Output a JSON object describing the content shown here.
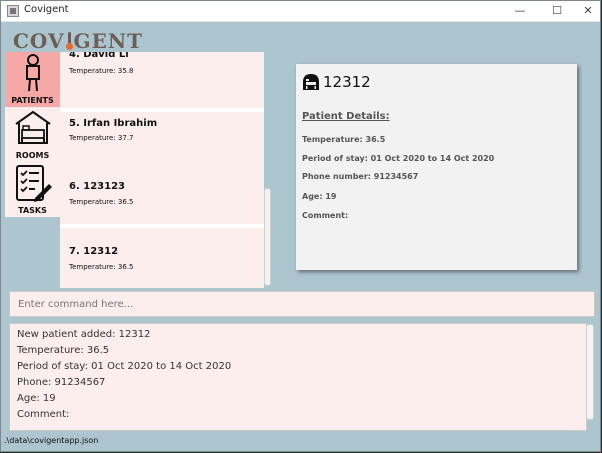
{
  "window": {
    "title": "Covigent"
  },
  "logo": {
    "text_before": "COV",
    "text_after": "GENT"
  },
  "sidebar": {
    "items": [
      {
        "label": "PATIENTS",
        "icon": "person-icon",
        "active": true
      },
      {
        "label": "ROOMS",
        "icon": "bed-icon",
        "active": false
      },
      {
        "label": "TASKS",
        "icon": "checklist-icon",
        "active": false
      }
    ]
  },
  "patients": [
    {
      "name": "4.  David Li",
      "temperature": "Temperature: 35.8"
    },
    {
      "name": "5.  Irfan Ibrahim",
      "temperature": "Temperature: 37.7"
    },
    {
      "name": "6.  123123",
      "temperature": "Temperature: 36.5"
    },
    {
      "name": "7.  12312",
      "temperature": "Temperature: 36.5"
    }
  ],
  "details": {
    "patient_id": "12312",
    "header": "Patient Details:",
    "temperature": "Temperature: 36.5",
    "period": "Period of stay: 01 Oct 2020 to 14 Oct 2020",
    "phone": "Phone number: 91234567",
    "age": "Age: 19",
    "comment": "Comment:"
  },
  "command": {
    "placeholder": "Enter command here..."
  },
  "output": {
    "lines": [
      "New patient added: 12312",
      "Temperature: 36.5",
      "Period of stay: 01 Oct 2020 to 14 Oct 2020",
      "Phone: 91234567",
      "Age: 19",
      "Comment:"
    ]
  },
  "status": {
    "path": ".\\data\\covigentapp.json"
  },
  "colors": {
    "background": "#adc5cf",
    "active_nav": "#f5a8a6",
    "card": "#fdeeee"
  }
}
